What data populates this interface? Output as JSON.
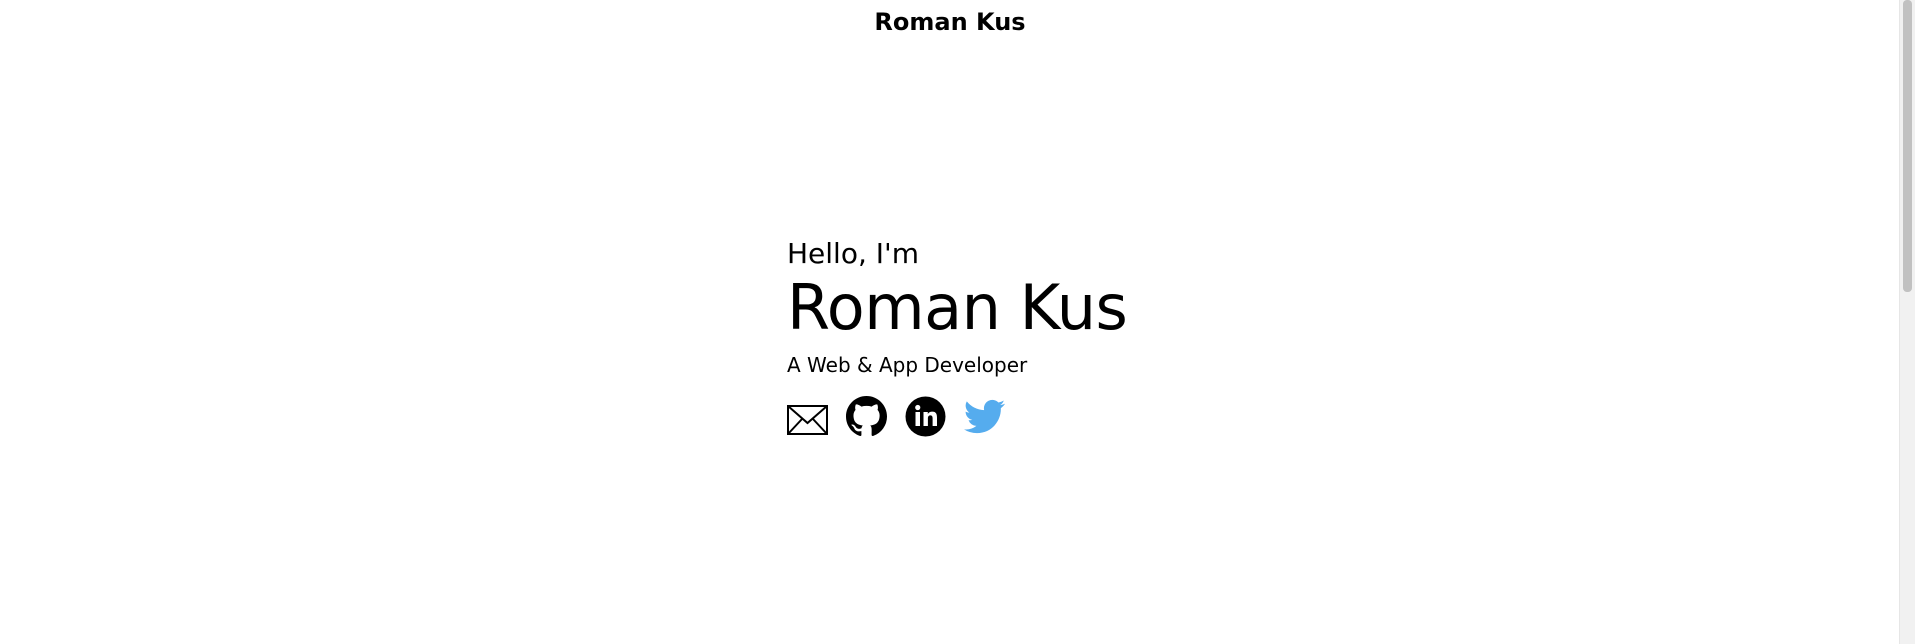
{
  "header": {
    "site_title": "Roman Kus"
  },
  "hero": {
    "greeting": "Hello, I'm",
    "name": "Roman Kus",
    "tagline": "A Web & App Developer"
  },
  "social": [
    {
      "icon": "envelope-icon",
      "label": "Email"
    },
    {
      "icon": "github-icon",
      "label": "GitHub"
    },
    {
      "icon": "linkedin-icon",
      "label": "LinkedIn"
    },
    {
      "icon": "twitter-icon",
      "label": "Twitter"
    }
  ],
  "colors": {
    "text": "#000000",
    "twitter": "#55ACEE",
    "background": "#ffffff"
  }
}
